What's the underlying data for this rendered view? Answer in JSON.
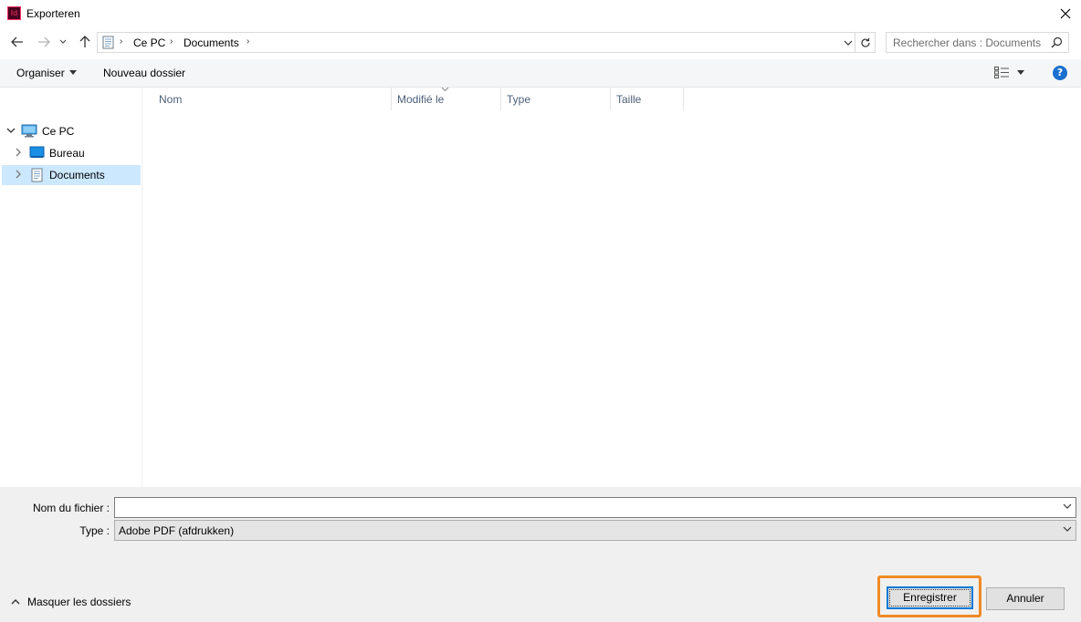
{
  "window": {
    "title": "Exporteren",
    "app_icon_text": "Id"
  },
  "address_bar": {
    "breadcrumbs": [
      "Ce PC",
      "Documents"
    ]
  },
  "search": {
    "placeholder": "Rechercher dans : Documents"
  },
  "toolbar": {
    "organize_label": "Organiser",
    "new_folder_label": "Nouveau dossier"
  },
  "nav_tree": {
    "items": [
      {
        "label": "Ce PC",
        "icon": "computer-icon",
        "expanded": true
      },
      {
        "label": "Bureau",
        "icon": "desktop-folder-icon",
        "expanded": false
      },
      {
        "label": "Documents",
        "icon": "documents-folder-icon",
        "expanded": false,
        "selected": true
      }
    ]
  },
  "file_list": {
    "columns": [
      "Nom",
      "Modifié le",
      "Type",
      "Taille"
    ],
    "rows": []
  },
  "form": {
    "filename_label": "Nom du fichier :",
    "filename_value": "",
    "type_label": "Type :",
    "type_value": "Adobe PDF (afdrukken)"
  },
  "footer": {
    "hide_folders_label": "Masquer les dossiers",
    "save_label": "Enregistrer",
    "cancel_label": "Annuler"
  },
  "colors": {
    "selection": "#cce8ff",
    "accent": "#0078d7",
    "highlight": "#f08a24",
    "help": "#1a6fcf"
  }
}
